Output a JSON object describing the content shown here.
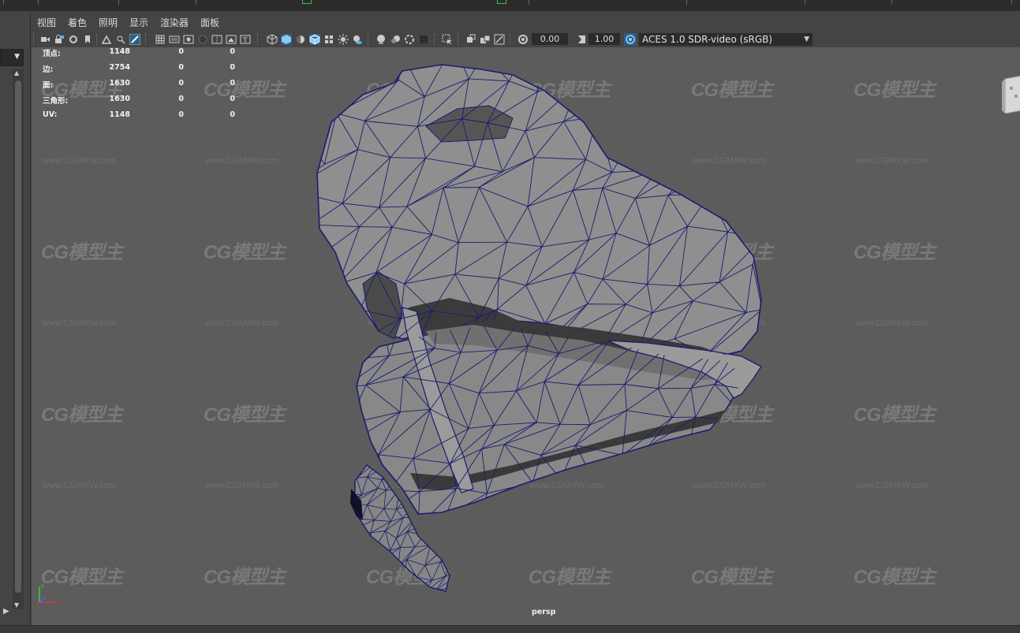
{
  "menu": {
    "items": [
      "视图",
      "着色",
      "照明",
      "显示",
      "渲染器",
      "面板"
    ]
  },
  "toolbar": {
    "exposure_value": "0.00",
    "gamma_value": "1.00",
    "color_space": "ACES 1.0 SDR-video (sRGB)"
  },
  "hud": {
    "rows": [
      {
        "label": "顶点:",
        "v1": "1148",
        "v2": "0",
        "v3": "0"
      },
      {
        "label": "边:",
        "v1": "2754",
        "v2": "0",
        "v3": "0"
      },
      {
        "label": "面:",
        "v1": "1630",
        "v2": "0",
        "v3": "0"
      },
      {
        "label": "三角形:",
        "v1": "1630",
        "v2": "0",
        "v3": "0"
      },
      {
        "label": "UV:",
        "v1": "1148",
        "v2": "0",
        "v3": "0"
      }
    ]
  },
  "viewport": {
    "camera_label": "persp",
    "watermark_logo": "CG模型主",
    "watermark_url": "www.CGMXW.com"
  },
  "colors": {
    "viewport_bg": "#5c5c5c",
    "mesh_fill": "#8f8f8f",
    "wire": "#1b1c6e",
    "icon_accent": "#5bb0e6"
  }
}
